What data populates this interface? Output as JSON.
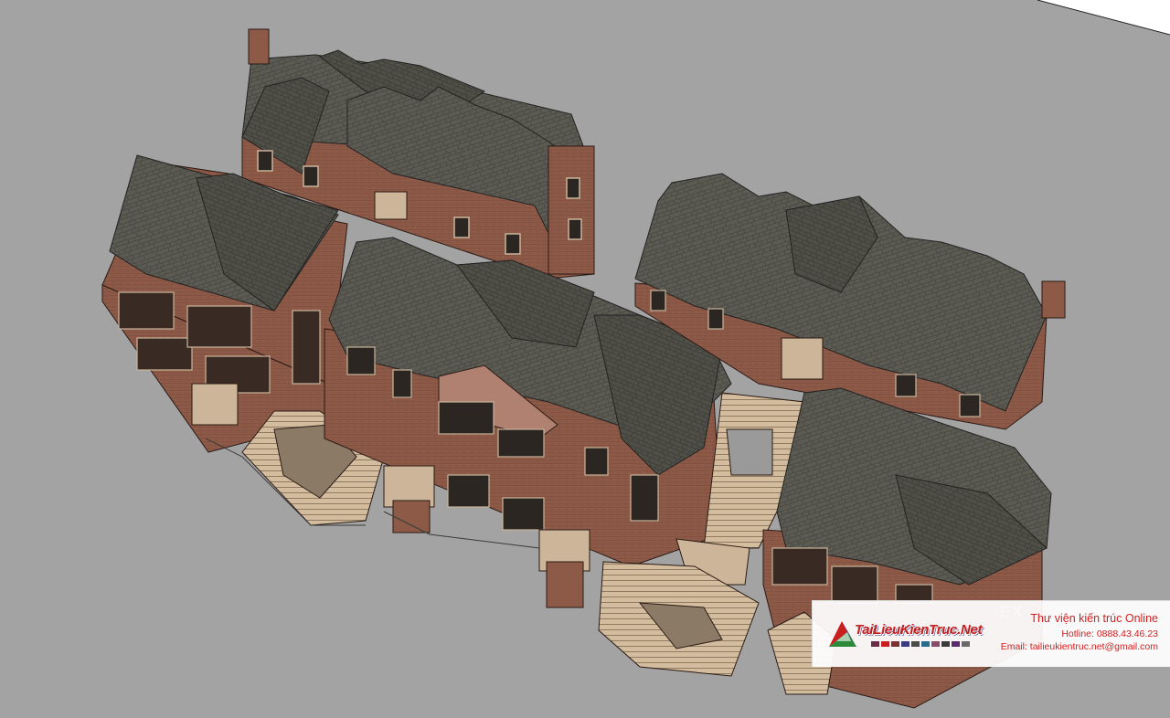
{
  "watermark": {
    "logo_text": "TaiLieuKienTruc.Net",
    "title": "Thư viện kiến trúc Online",
    "hotline": "Hotline: 0888.43.46.23",
    "email": "Email: tailieukientruc.net@gmail.com"
  },
  "colors": {
    "ground": "#a3a3a3",
    "roof": "#5a5a52",
    "roof_dark": "#3f3f39",
    "brick": "#8e5a48",
    "brick_dark": "#6e4336",
    "stone": "#cdb59a",
    "accent_red": "#d42020"
  }
}
